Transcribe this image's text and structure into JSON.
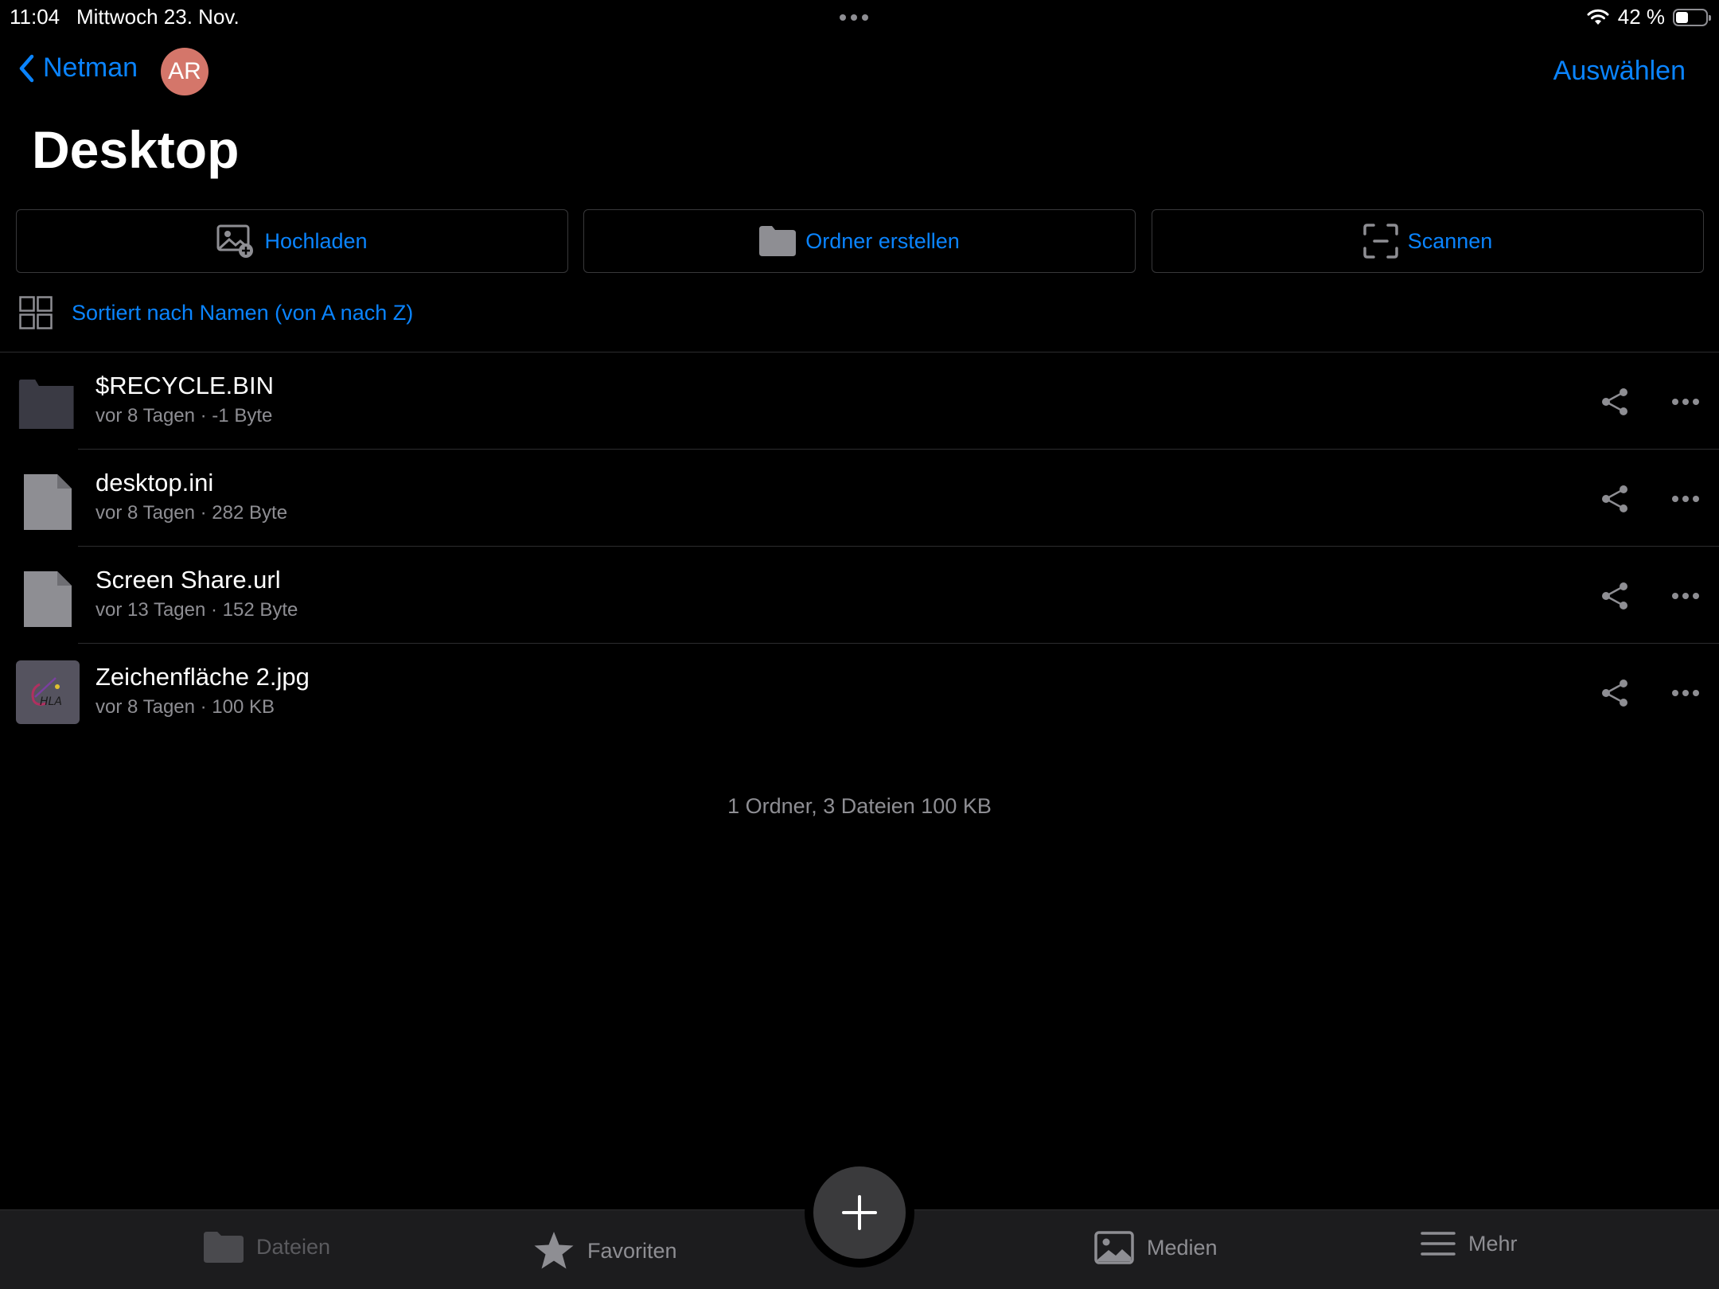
{
  "status_bar": {
    "time": "11:04",
    "date": "Mittwoch 23. Nov.",
    "battery": "42 %",
    "battery_level": 0.42
  },
  "nav": {
    "back_label": "Netman",
    "avatar_initials": "AR",
    "select_label": "Auswählen"
  },
  "title": "Desktop",
  "actions": {
    "upload": "Hochladen",
    "create_folder": "Ordner erstellen",
    "scan": "Scannen"
  },
  "sort_label": "Sortiert nach Namen (von A nach Z)",
  "files": [
    {
      "name": "$RECYCLE.BIN",
      "meta": "vor 8 Tagen · -1 Byte",
      "type": "folder"
    },
    {
      "name": "desktop.ini",
      "meta": "vor 8 Tagen · 282 Byte",
      "type": "file"
    },
    {
      "name": "Screen Share.url",
      "meta": "vor 13 Tagen · 152 Byte",
      "type": "file"
    },
    {
      "name": "Zeichenfläche 2.jpg",
      "meta": "vor 8 Tagen · 100 KB",
      "type": "image"
    }
  ],
  "summary": "1 Ordner, 3 Dateien 100 KB",
  "tabs": {
    "files": "Dateien",
    "favorites": "Favoriten",
    "media": "Medien",
    "more": "Mehr"
  },
  "colors": {
    "accent": "#0a84ff",
    "background": "#000000",
    "secondary_text": "#8e8e93",
    "avatar": "#d4766a"
  }
}
